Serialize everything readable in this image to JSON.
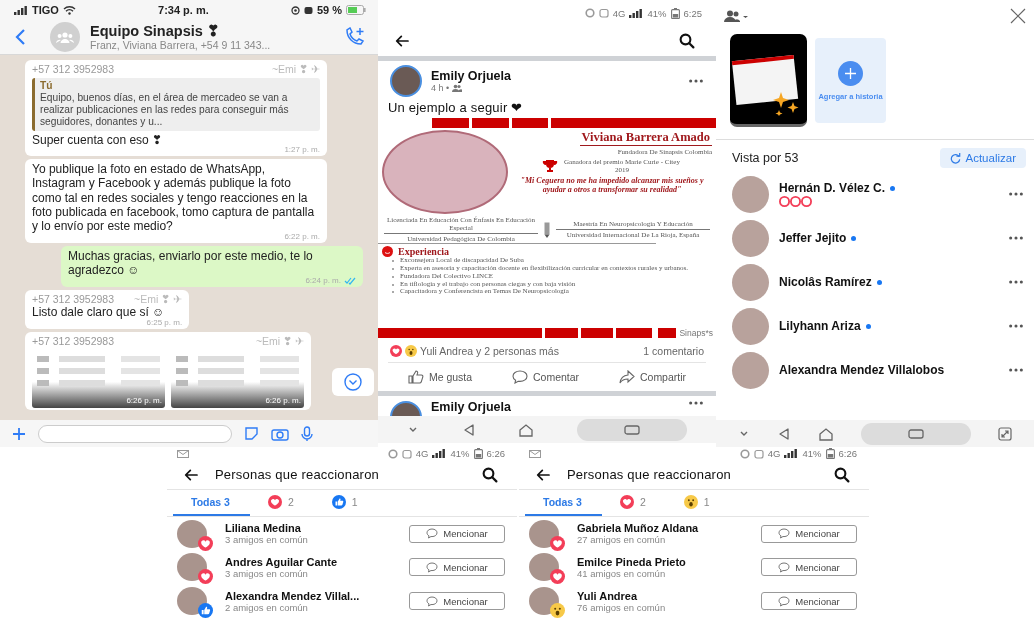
{
  "chat": {
    "status_bar": {
      "carrier": "TIGO",
      "time": "7:34 p. m.",
      "battery": "59 %"
    },
    "header": {
      "title": "Equipo Sinapsis ❣",
      "subtitle": "Franz, Viviana Barrera, +54 9 11 343..."
    },
    "messages": [
      {
        "kind": "incoming",
        "sender": "+57 312 3952983",
        "sender_name": "~Emi ❣ ✈",
        "quote": {
          "author": "Tú",
          "text": "Equipo, buenos días, en el área de mercadeo se van a realizar publicaciones en las redes para conseguir más seguidores, donantes y u..."
        },
        "text": "Super cuenta con eso ❣",
        "time": "1:27 p. m."
      },
      {
        "kind": "incoming",
        "text": "Yo publique la foto en estado de WhatsApp, Instagram y Facebook y además publique la foto como tal en redes sociales y tengo reacciones en la foto publicada en facebook, tomo captura de pantalla y lo envío por este medio?",
        "time": "6:22 p. m."
      },
      {
        "kind": "outgoing",
        "text": "Muchas gracias, enviarlo por este medio, te lo agradezco ☺",
        "time": "6:24 p. m.",
        "read": true
      },
      {
        "kind": "incoming",
        "sender": "+57 312 3952983",
        "sender_name": "~Emi ❣ ✈",
        "text": "Listo dale claro que sí ☺",
        "time": "6:25 p. m."
      },
      {
        "kind": "images",
        "sender": "+57 312 3952983",
        "sender_name": "~Emi ❣ ✈",
        "images": [
          {
            "time": "6:26 p. m."
          },
          {
            "time": "6:26 p. m."
          }
        ]
      }
    ]
  },
  "post_screen": {
    "status_bar": {
      "network": "4G",
      "battery": "41%",
      "time": "6:25"
    },
    "post": {
      "author": "Emily Orjuela",
      "meta": "4 h •",
      "text": "Un ejemplo a seguir ❤",
      "flyer": {
        "name": "Viviana Barrera Amado",
        "role": "Fundadora De Sinapsis Colombia",
        "award": "Ganadora del premio Marie Curie - Citey 2019",
        "quote": "\"Mi Ceguera no me ha impedido alcanzar mis sueños y ayudar a otros a transformar su realidad\"",
        "education": [
          {
            "degree": "Licenciada En Educación Con Énfasis En Educación Especial",
            "school": "Universidad Pedagógica De Colombia"
          },
          {
            "degree": "Maestría En Neuropsicología Y Educación",
            "school": "Universidad Internacional De La Rioja, España"
          }
        ],
        "section": "Experiencia",
        "items": [
          "Exconsejera Local de discapacidad De Suba",
          "Experta en asesoría y capacitación docente en flexibilización curricular en contextos rurales y urbanos.",
          "Fundadora Del Colectivo LINCE",
          "En tiflología y el trabajo con personas ciegas y con baja visión",
          "Capacitadora y Conferencista en Temas De Neuropsicología"
        ],
        "logo": "Sinaps*s"
      },
      "reactions": "Yuli Andrea y 2 personas más",
      "comments": "1 comentario",
      "actions": [
        {
          "kind": "like",
          "label": "Me gusta"
        },
        {
          "kind": "comment",
          "label": "Comentar"
        },
        {
          "kind": "share",
          "label": "Compartir"
        }
      ]
    },
    "next_post": {
      "author": "Emily Orjuela"
    }
  },
  "stories": {
    "add_story": "Agregar a historia",
    "viewed_by": "Vista por 53",
    "refresh": "Actualizar",
    "viewers": [
      {
        "name": "Hernán D. Vélez C.",
        "online": true,
        "reactions": [
          {
            "kind": "love"
          },
          {
            "kind": "love"
          },
          {
            "kind": "love"
          }
        ]
      },
      {
        "name": "Jeffer Jejito",
        "online": true
      },
      {
        "name": "Nicolâs Ramírez",
        "online": true
      },
      {
        "name": "Lilyhann Ariza",
        "online": true
      },
      {
        "name": "Alexandra Mendez Villalobos",
        "online": false
      }
    ]
  },
  "reaction_screens": [
    {
      "status_bar": {
        "network": "4G",
        "battery": "41%",
        "time": "6:26"
      },
      "title": "Personas que reaccionaron",
      "tabs": [
        {
          "kind": "all",
          "label": "Todas 3",
          "selected": true
        },
        {
          "kind": "love",
          "label": "2",
          "selected": false
        },
        {
          "kind": "like",
          "label": "1",
          "selected": false
        }
      ],
      "people": [
        {
          "name": "Liliana Medina",
          "mutual": "3 amigos en común",
          "kind": "love",
          "button": "Mencionar"
        },
        {
          "name": "Andres Aguilar Cante",
          "mutual": "3 amigos en común",
          "kind": "love",
          "button": "Mencionar"
        },
        {
          "name": "Alexandra Mendez Villal...",
          "mutual": "2 amigos en común",
          "kind": "like",
          "button": "Mencionar"
        }
      ]
    },
    {
      "status_bar": {
        "network": "4G",
        "battery": "41%",
        "time": "6:26"
      },
      "title": "Personas que reaccionaron",
      "tabs": [
        {
          "kind": "all",
          "label": "Todas 3",
          "selected": true
        },
        {
          "kind": "love",
          "label": "2",
          "selected": false
        },
        {
          "kind": "wow",
          "label": "1",
          "selected": false
        }
      ],
      "people": [
        {
          "name": "Gabriela Muñoz Aldana",
          "mutual": "27 amigos en común",
          "kind": "love",
          "button": "Mencionar"
        },
        {
          "name": "Emilce Pineda Prieto",
          "mutual": "41 amigos en común",
          "kind": "love",
          "button": "Mencionar"
        },
        {
          "name": "Yuli Andrea",
          "mutual": "76 amigos en común",
          "kind": "wow",
          "button": "Mencionar"
        }
      ]
    }
  ]
}
